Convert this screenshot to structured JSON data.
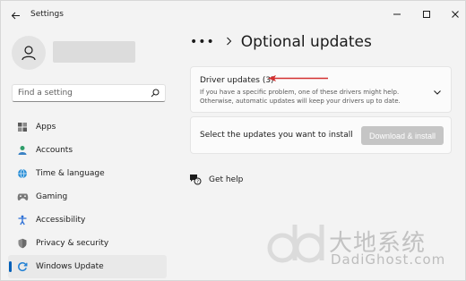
{
  "window": {
    "title": "Settings",
    "controls": [
      "minimize",
      "maximize",
      "close"
    ]
  },
  "search": {
    "placeholder": "Find a setting"
  },
  "sidebar": {
    "items": [
      {
        "label": "Apps",
        "icon": "apps-icon",
        "active": false
      },
      {
        "label": "Accounts",
        "icon": "accounts-icon",
        "active": false
      },
      {
        "label": "Time & language",
        "icon": "time-language-icon",
        "active": false
      },
      {
        "label": "Gaming",
        "icon": "gaming-icon",
        "active": false
      },
      {
        "label": "Accessibility",
        "icon": "accessibility-icon",
        "active": false
      },
      {
        "label": "Privacy & security",
        "icon": "shield-icon",
        "active": false
      },
      {
        "label": "Windows Update",
        "icon": "windows-update-icon",
        "active": true
      }
    ]
  },
  "breadcrumb": {
    "more": "•••",
    "title": "Optional updates"
  },
  "driver_updates": {
    "title": "Driver updates (3)",
    "description_line1": "If you have a specific problem, one of these drivers might help.",
    "description_line2": "Otherwise, automatic updates will keep your drivers up to date."
  },
  "install": {
    "text": "Select the updates you want to install",
    "button_label": "Download & install"
  },
  "help": {
    "label": "Get help"
  },
  "watermark": {
    "cn": "大地系统",
    "en": "DadiGhost.com"
  },
  "colors": {
    "accent": "#005fb8",
    "annotation_arrow": "#d32f2f",
    "disabled_button": "#c5c5c5"
  }
}
